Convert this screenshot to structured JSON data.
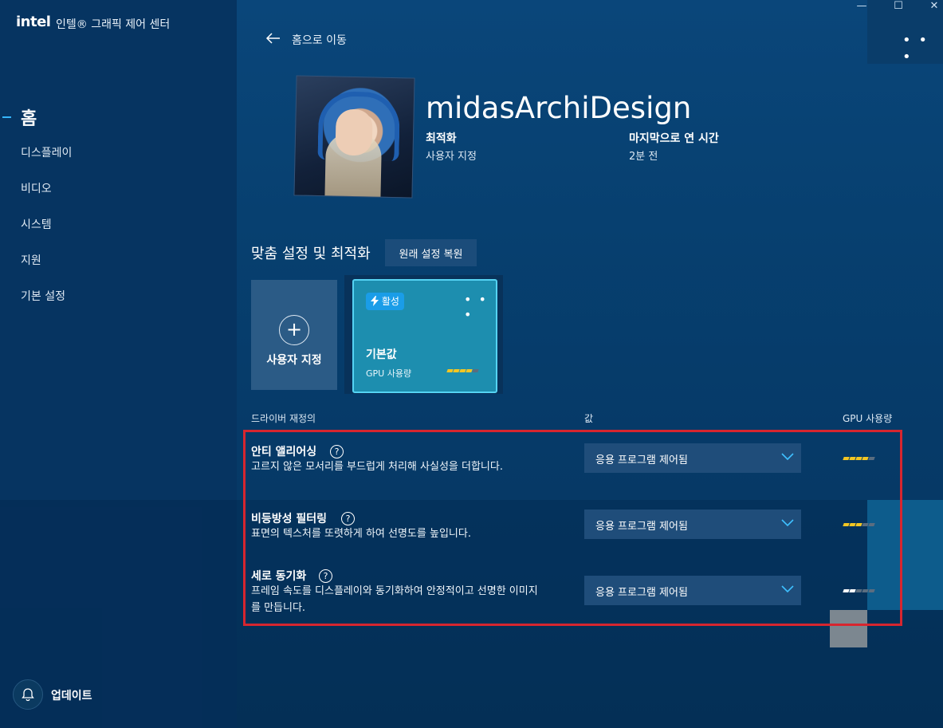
{
  "window": {
    "minimize": "—",
    "maximize": "☐",
    "close": "✕"
  },
  "header": {
    "logo": "intel",
    "title": "인텔® 그래픽 제어 센터"
  },
  "sidebar": {
    "active": "홈",
    "items": [
      {
        "label": "디스플레이"
      },
      {
        "label": "비디오"
      },
      {
        "label": "시스템"
      },
      {
        "label": "지원"
      },
      {
        "label": "기본 설정"
      }
    ],
    "update_label": "업데이트"
  },
  "topbar": {
    "back_label": "홈으로 이동",
    "more": "• • •"
  },
  "profile": {
    "name": "midasArchiDesign",
    "optimization_label": "최적화",
    "optimization_value": "사용자 지정",
    "last_opened_label": "마지막으로 연 시간",
    "last_opened_value": "2분 전"
  },
  "customization": {
    "title": "맞춤 설정 및 최적화",
    "reset_label": "원래 설정 복원",
    "custom_card_label": "사용자 지정",
    "plus": "+",
    "active_profile": {
      "badge": "활성",
      "more": "• • •",
      "name": "기본값",
      "gpu_label": "GPU 사용량",
      "gpu_level": 4,
      "gpu_max": 5
    }
  },
  "table": {
    "headers": {
      "driver": "드라이버 재정의",
      "value": "값",
      "gpu": "GPU 사용량"
    },
    "rows": [
      {
        "name": "안티 앨리어싱",
        "help": "?",
        "desc": "고르지 않은 모서리를 부드럽게 처리해 사실성을 더합니다.",
        "value": "응용 프로그램 제어됨",
        "gpu_level": 4,
        "gpu_max": 5
      },
      {
        "name": "비등방성 필터링",
        "help": "?",
        "desc": "표면의 텍스처를 또렷하게 하여 선명도를 높입니다.",
        "value": "응용 프로그램 제어됨",
        "gpu_level": 3,
        "gpu_max": 5
      },
      {
        "name": "세로 동기화",
        "help": "?",
        "desc": "프레임 속도를 디스플레이와 동기화하여 안정적이고 선명한 이미지를 만듭니다.",
        "value": "응용 프로그램 제어됨",
        "gpu_level": 2,
        "gpu_max": 5
      }
    ]
  },
  "colors": {
    "accent": "#35b5ff",
    "highlight_border": "#d7262f",
    "gpu_on": "#f3c623"
  }
}
